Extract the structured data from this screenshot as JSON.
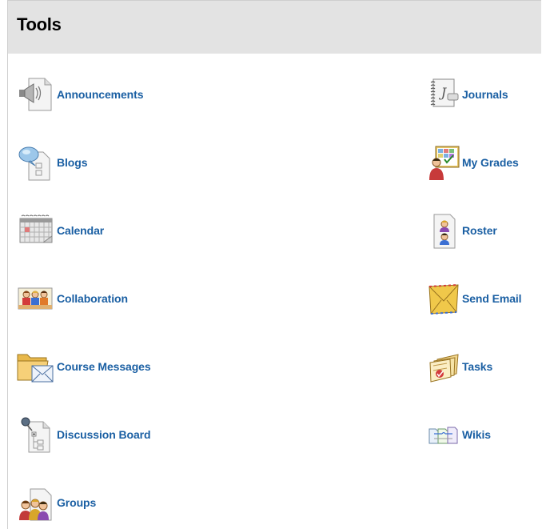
{
  "header": {
    "title": "Tools"
  },
  "tools_left": [
    {
      "label": "Announcements",
      "icon": "megaphone-page-icon"
    },
    {
      "label": "Blogs",
      "icon": "blog-page-icon"
    },
    {
      "label": "Calendar",
      "icon": "calendar-icon"
    },
    {
      "label": "Collaboration",
      "icon": "collaboration-icon"
    },
    {
      "label": "Course Messages",
      "icon": "folder-envelope-icon"
    },
    {
      "label": "Discussion Board",
      "icon": "discussion-board-icon"
    },
    {
      "label": "Groups",
      "icon": "groups-icon"
    }
  ],
  "tools_right": [
    {
      "label": "Journals",
      "icon": "journal-notebook-icon"
    },
    {
      "label": "My Grades",
      "icon": "grades-board-icon"
    },
    {
      "label": "Roster",
      "icon": "roster-icon"
    },
    {
      "label": "Send Email",
      "icon": "envelope-icon"
    },
    {
      "label": "Tasks",
      "icon": "task-papers-icon"
    },
    {
      "label": "Wikis",
      "icon": "wiki-pages-icon"
    }
  ],
  "colors": {
    "link": "#1a5fa3",
    "header_bg": "#e3e3e3"
  }
}
